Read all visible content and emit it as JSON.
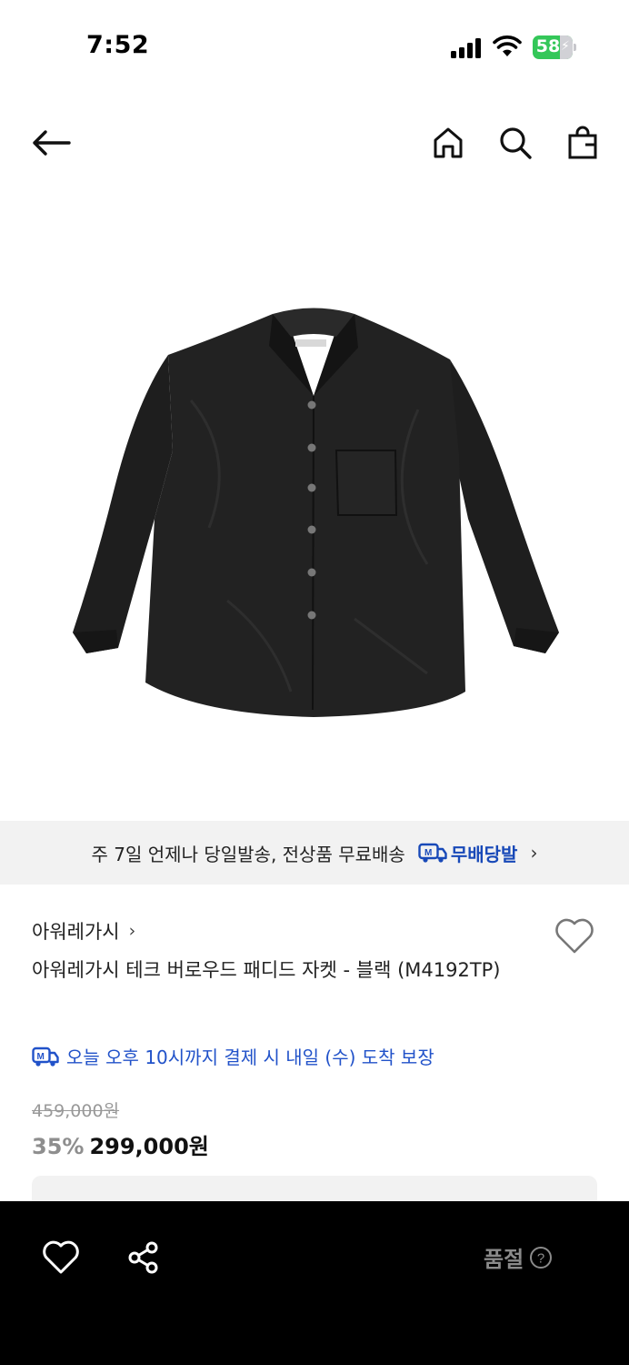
{
  "status_bar": {
    "time": "7:52",
    "battery_level": "58",
    "icons": [
      "signal-icon",
      "wifi-icon",
      "battery-icon"
    ]
  },
  "nav": {
    "icons": [
      "back-arrow-icon",
      "home-icon",
      "search-icon",
      "shopping-bag-icon"
    ]
  },
  "product_image": {
    "subject": "black padded jacket"
  },
  "delivery_banner": {
    "text": "주 7일 언제나 당일발송, 전상품 무료배송",
    "badge_label": "무배당발",
    "chevron": "›",
    "accent_color": "#1849b8"
  },
  "product": {
    "brand": "아워레가시",
    "brand_chevron": "›",
    "title": "아워레가시 테크 버로우드 패디드 자켓 - 블랙 (M4192TP)",
    "arrival_notice": "오늘 오후 10시까지 결제 시 내일 (수) 도착 보장",
    "original_price": "459,000원",
    "discount": "35%",
    "sale_price": "299,000원",
    "link_color": "#2152c9"
  },
  "bottom_bar": {
    "soldout_label": "품절",
    "icons": [
      "heart-outline-icon",
      "share-icon",
      "question-circle-icon"
    ]
  }
}
